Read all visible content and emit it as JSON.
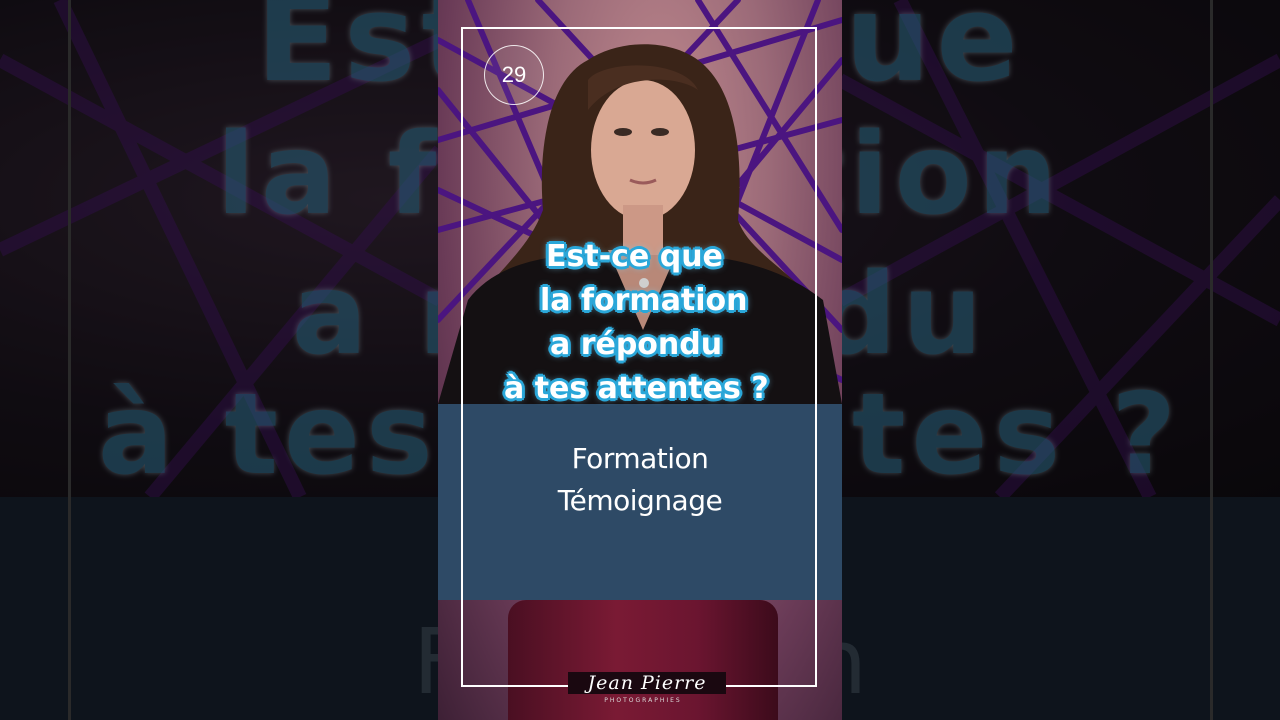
{
  "episode_number": "29",
  "question_lines": [
    "Est-ce que",
    "la formation",
    "a répondu",
    "à tes attentes ?"
  ],
  "panel": {
    "line1": "Formation",
    "line2": "Témoignage"
  },
  "signature": {
    "name": "Jean Pierre",
    "tagline": "PHOTOGRAPHIES"
  },
  "colors": {
    "panel_bg": "#2e4a66",
    "question_outline": "#2aa7d9",
    "frame_border": "#ffffff"
  }
}
